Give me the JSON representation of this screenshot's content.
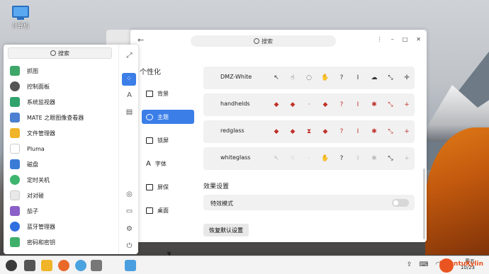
{
  "desktop": {
    "icon_label": "计算机"
  },
  "window": {
    "search_placeholder": "搜索",
    "section_title": "个性化",
    "nav": [
      "背景",
      "主题",
      "锁屏",
      "字体",
      "屏保",
      "桌面"
    ],
    "cursor_themes": [
      "DMZ-White",
      "handhelds",
      "redglass",
      "whiteglass"
    ],
    "effects_title": "效果设置",
    "effects_label": "特效模式",
    "reset_label": "恢复默认设置"
  },
  "start_menu": {
    "search_placeholder": "搜索",
    "apps": [
      "抓图",
      "控制面板",
      "系统监视器",
      "MATE 之眼图像查看器",
      "文件管理器",
      "Pluma",
      "磁盘",
      "定时关机",
      "对对碰",
      "茄子",
      "蓝牙管理器",
      "密码和密钥"
    ]
  },
  "taskbar": {
    "watermark_label": "UbuntuKylin",
    "clock_date": "10/23",
    "clock_day": "周五"
  },
  "colors": {
    "accent": "#3b7ee8",
    "ubuntu": "#e95420"
  }
}
